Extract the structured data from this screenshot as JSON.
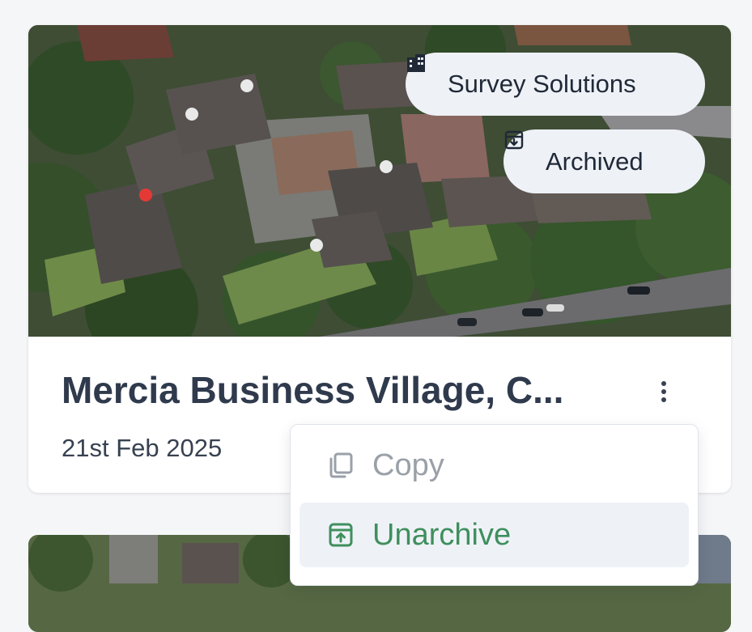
{
  "project_card": {
    "image_alt": "Aerial view of Mercia Business Village",
    "organization": "Survey Solutions",
    "status": "Archived",
    "title": "Mercia Business Village, C...",
    "date": "21st Feb 2025"
  },
  "context_menu": {
    "items": [
      {
        "label": "Copy",
        "icon": "copy-icon",
        "disabled": true
      },
      {
        "label": "Unarchive",
        "icon": "unarchive-icon",
        "highlighted": true
      }
    ]
  },
  "colors": {
    "page_bg": "#f5f6f8",
    "title": "#2f3a4d",
    "unarchive": "#3f8f5d",
    "disabled": "#9aa0a8",
    "pill_bg": "#eef1f6"
  }
}
